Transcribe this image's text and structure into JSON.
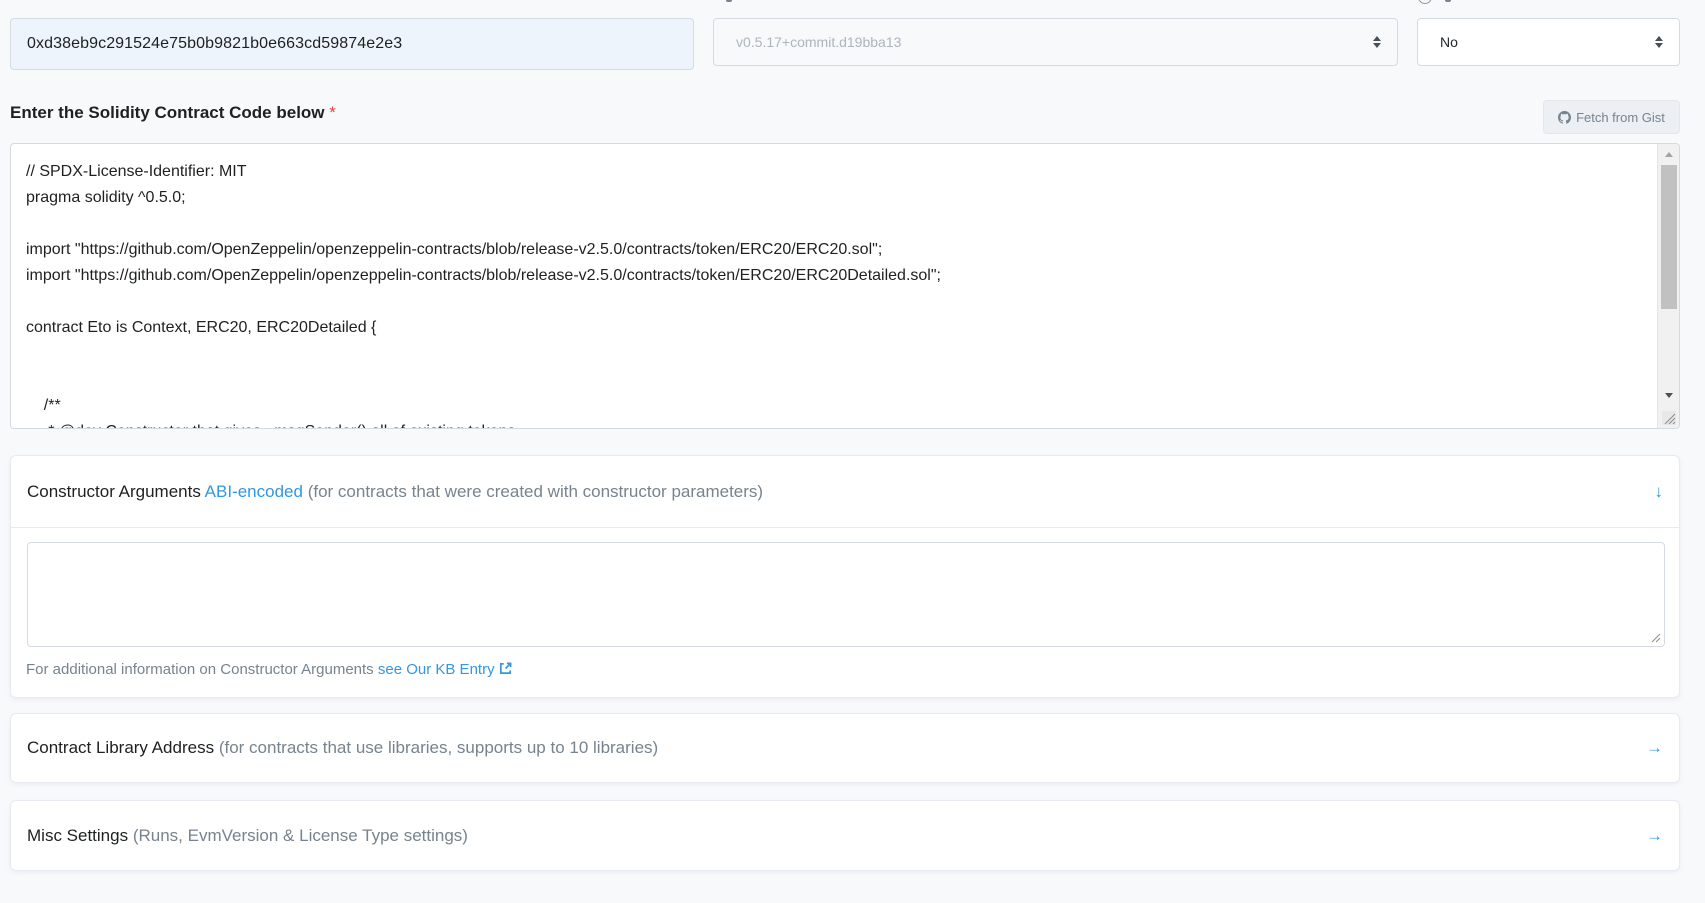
{
  "top": {
    "address_value": "0xd38eb9c291524e75b0b9821b0e663cd59874e2e3",
    "compiler_value": "v0.5.17+commit.d19bba13",
    "optimization_value": "No"
  },
  "code_section": {
    "label": "Enter the Solidity Contract Code below",
    "required_mark": "*",
    "gist_button": "Fetch from Gist",
    "code": "// SPDX-License-Identifier: MIT\npragma solidity ^0.5.0;\n\nimport \"https://github.com/OpenZeppelin/openzeppelin-contracts/blob/release-v2.5.0/contracts/token/ERC20/ERC20.sol\";\nimport \"https://github.com/OpenZeppelin/openzeppelin-contracts/blob/release-v2.5.0/contracts/token/ERC20/ERC20Detailed.sol\";\n\ncontract Eto is Context, ERC20, ERC20Detailed {\n\n\n    /**\n     * @dev Constructor that gives _msgSender() all of existing tokens.\n     */"
  },
  "constructor_args": {
    "title": "Constructor Arguments",
    "link": "ABI-encoded",
    "note": "(for contracts that were created with constructor parameters)",
    "info_text": "For additional information on Constructor Arguments",
    "info_link": "see Our KB Entry"
  },
  "library": {
    "title": "Contract Library Address",
    "note": "(for contracts that use libraries, supports up to 10 libraries)"
  },
  "misc": {
    "title": "Misc Settings",
    "note": "(Runs, EvmVersion & License Type settings)"
  },
  "colors": {
    "link": "#3498db",
    "required": "#de4437",
    "muted": "#77838f"
  }
}
